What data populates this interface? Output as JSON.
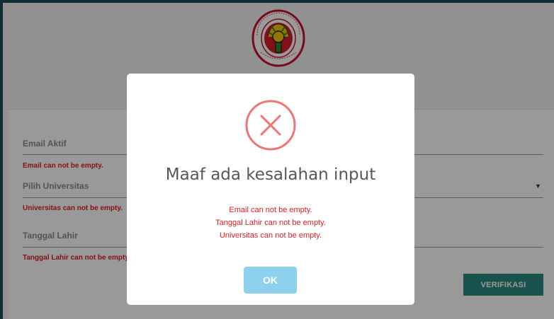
{
  "logo": {
    "text_top": "PERHIMPUNAN SPESIALIS BEDAH SARAF",
    "text_bottom": "INDONESIA"
  },
  "form": {
    "email_label": "Email Aktif",
    "email_error": "Email can not be empty.",
    "university_label": "Pilih Universitas",
    "university_error": "Universitas can not be empty.",
    "dob_label": "Tanggal Lahir",
    "dob_error": "Tanggal Lahir can not be empty.",
    "verify_label": "VERIFIKASI"
  },
  "modal": {
    "title": "Maaf ada kesalahan input",
    "messages": [
      "Email can not be empty.",
      "Tanggal Lahir can not be empty.",
      "Universitas can not be empty."
    ],
    "ok_label": "OK"
  },
  "colors": {
    "error": "#e02020",
    "accent": "#2a8a80",
    "ok_button": "#8ed1ee",
    "error_icon": "#f27474"
  }
}
